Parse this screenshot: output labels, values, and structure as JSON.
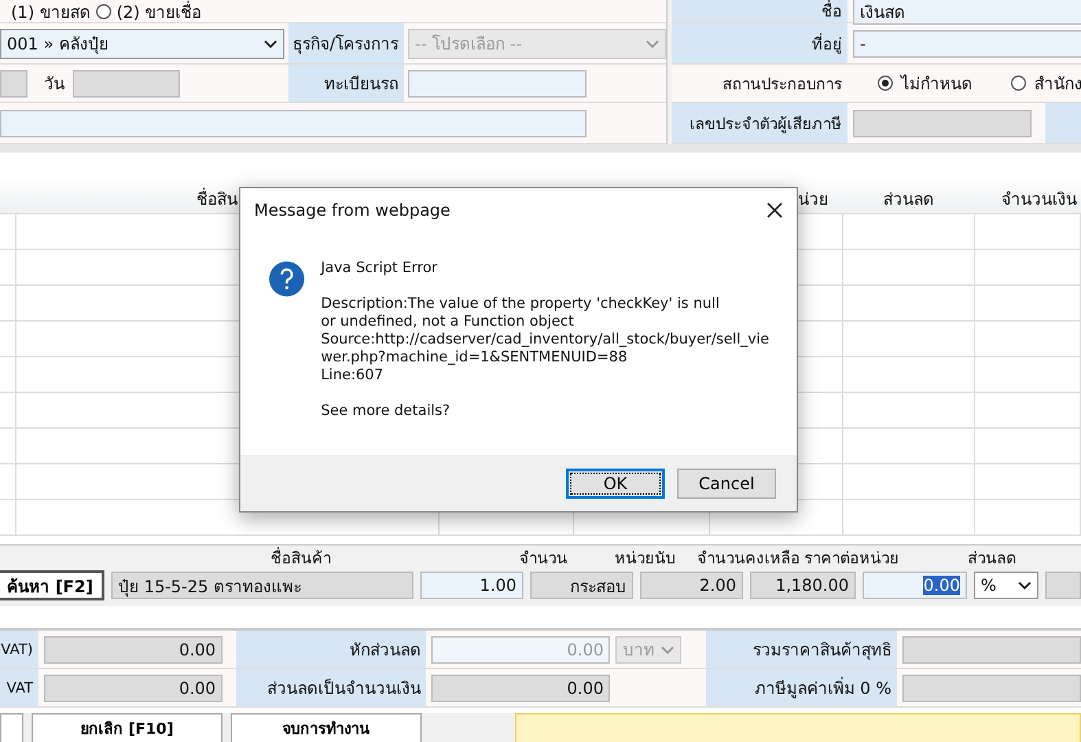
{
  "sale_type": {
    "cash_label": "(1) ขายสด",
    "credit": {
      "label": "(2) ขายเชื่อ",
      "selected": false
    }
  },
  "form": {
    "warehouse": "001 » คลังปุ๋ย",
    "project_label": "ธุรกิจ/โครงการ",
    "project_placeholder": "-- โปรดเลือก --",
    "day_label": "วัน",
    "plate_label": "ทะเบียนรถ"
  },
  "customer": {
    "name_label": "ชื่อ",
    "name": "เงินสด",
    "address_label": "ที่อยู่",
    "address": "-",
    "branch_label": "สถานประกอบการ",
    "branch_options": [
      {
        "label": "ไม่กำหนด",
        "selected": true
      },
      {
        "label": "สำนักง",
        "selected": false
      }
    ],
    "tax_id_label": "เลขประจำตัวผู้เสียภาษี"
  },
  "grid": {
    "columns": [
      "ชื่อสิน",
      "น่วย",
      "ส่วนลด",
      "จำนวนเงิน"
    ]
  },
  "entry": {
    "search_button": "ค้นหา [F2]",
    "headers": [
      "ชื่อสินค้า",
      "จำนวน",
      "หน่วยนับ",
      "จำนวนคงเหลือ",
      "ราคาต่อหน่วย",
      "ส่วนลด"
    ],
    "product": "ปุ๋ย 15-5-25 ตราทองแพะ",
    "quantity": "1.00",
    "unit": "กระสอบ",
    "remaining": "2.00",
    "unit_price": "1,180.00",
    "discount": "0.00",
    "discount_unit": "%"
  },
  "summary": {
    "rows": [
      {
        "label": "VAT)",
        "value": "0.00",
        "mid_label": "หักส่วนลด",
        "mid_value": "0.00",
        "mid_unit": "บาท",
        "right_label": "รวมราคาสินค้าสุทธิ"
      },
      {
        "label": "VAT",
        "value": "0.00",
        "mid_label": "ส่วนลดเป็นจำนวนเงิน",
        "mid_value": "0.00",
        "right_label": "ภาษีมูลค่าเพิ่ม 0 %"
      }
    ]
  },
  "buttons": [
    "ยกเลิก [F10]",
    "จบการทำงาน"
  ],
  "dialog": {
    "title": "Message from webpage",
    "heading": "Java Script Error",
    "description": "Description:The value of the property 'checkKey' is null or undefined, not a Function object",
    "source": "Source:http://cadserver/cad_inventory/all_stock/buyer/sell_vie",
    "source_cont": "wer.php?machine_id=1&SENTMENUID=88",
    "line": "Line:607",
    "question": "See more details?",
    "buttons": [
      {
        "label": "OK",
        "selected": true
      },
      {
        "label": "Cancel",
        "selected": false
      }
    ]
  }
}
